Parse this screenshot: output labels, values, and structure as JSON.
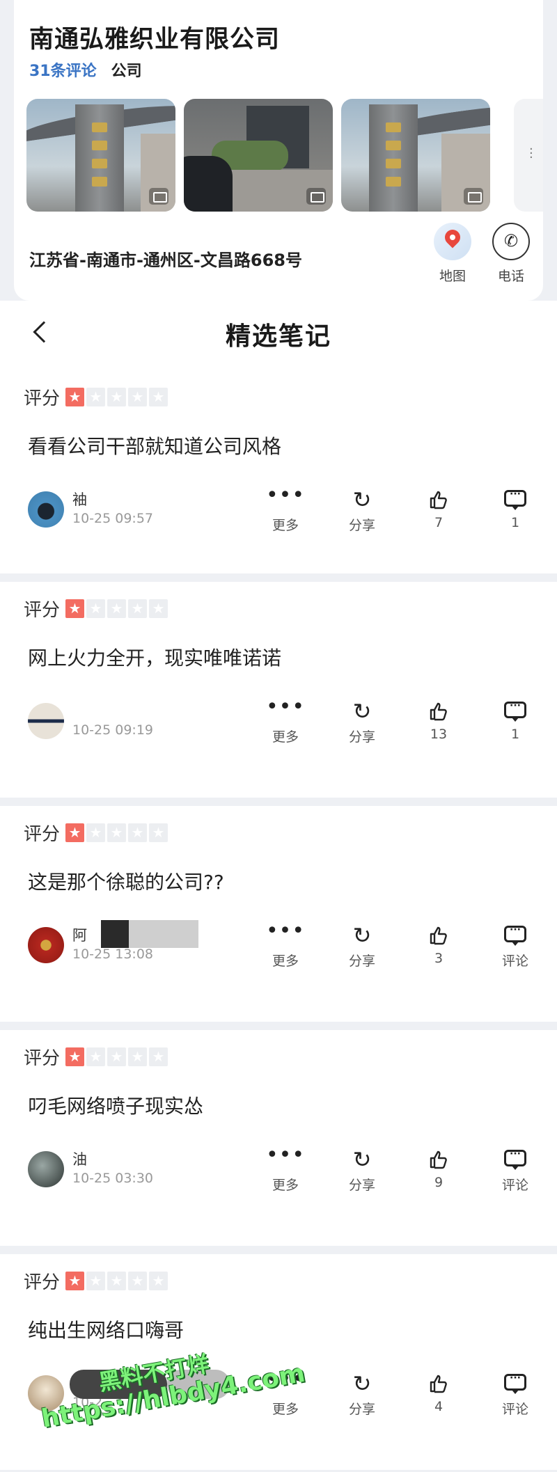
{
  "company": {
    "name": "南通弘雅织业有限公司",
    "reviews_link": "31条评论",
    "category": "公司",
    "address": "江苏省-南通市-通州区-文昌路668号",
    "map_label": "地图",
    "phone_label": "电话",
    "photos": [
      "gate-photo",
      "entrance-photo",
      "gate-photo"
    ]
  },
  "header": {
    "title": "精选笔记"
  },
  "rating_label": "评分",
  "actions": {
    "more": "更多",
    "share": "分享"
  },
  "reviews": [
    {
      "rating": 1,
      "text": "看看公司干部就知道公司风格",
      "author": "袖",
      "time": "10-25 09:57",
      "likes": "7",
      "comment": "1"
    },
    {
      "rating": 1,
      "text": "网上火力全开，现实唯唯诺诺",
      "author": "",
      "time": "10-25 09:19",
      "likes": "13",
      "comment": "1"
    },
    {
      "rating": 1,
      "text": "这是那个徐聪的公司??",
      "author": "阿",
      "time": "10-25 13:08",
      "likes": "3",
      "comment": "评论"
    },
    {
      "rating": 1,
      "text": "叼毛网络喷子现实怂",
      "author": "油",
      "time": "10-25 03:30",
      "likes": "9",
      "comment": "评论"
    },
    {
      "rating": 1,
      "text": "纯出生网络口嗨哥",
      "author": "",
      "time": "10-2",
      "likes": "4",
      "comment": "评论"
    }
  ],
  "watermark": {
    "line1": "黑料不打烊",
    "line2": "https://hlbdy4.com"
  },
  "colors": {
    "star_active": "#f36c61",
    "link_blue": "#3a74c4",
    "watermark_green": "#7df27a"
  }
}
